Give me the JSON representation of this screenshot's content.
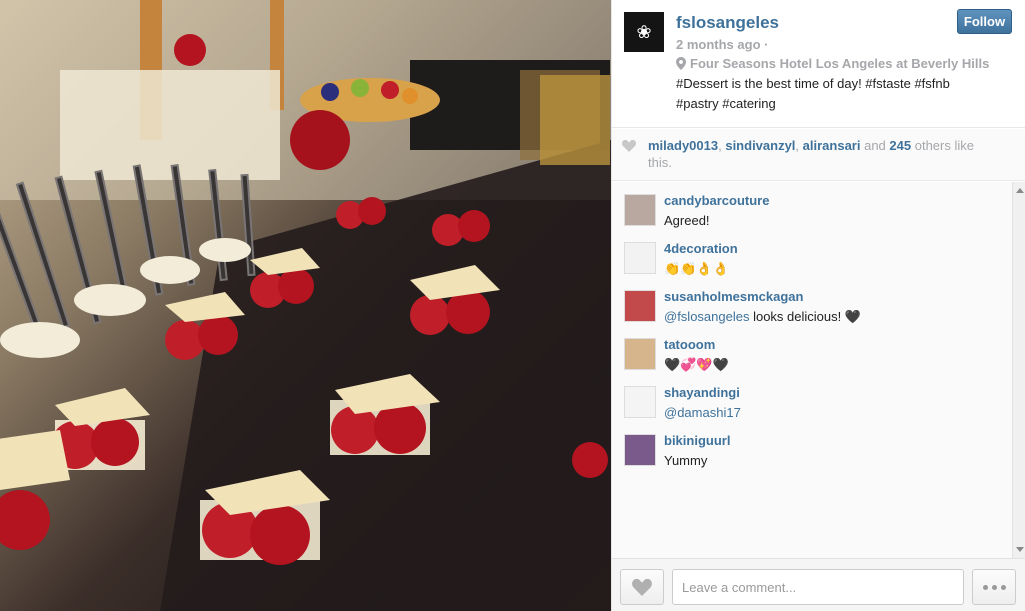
{
  "post": {
    "photo_alt": "Raspberry pastry desserts and spoons on a catering table",
    "author": "fslosangeles",
    "follow_label": "Follow",
    "time_ago": "2 months ago ·",
    "location": "Four Seasons Hotel Los Angeles at Beverly Hills",
    "caption_line1": "#Dessert is the best time of day! #fstaste #fsfnb",
    "caption_line2": "#pastry #catering"
  },
  "likes": {
    "users": [
      "milady0013",
      "sindivanzyl",
      "aliransari"
    ],
    "sep1": ", ",
    "sep2": ", ",
    "and_text": " and ",
    "count": "245",
    "others_text": " others like",
    "line2": "this."
  },
  "comments": [
    {
      "user": "candybarcouture",
      "text": "Agreed!",
      "avatar_color": "#b9a8a0"
    },
    {
      "user": "4decoration",
      "text": "👏👏👌👌",
      "avatar_color": "#f2f2f2"
    },
    {
      "user": "susanholmesmckagan",
      "mention": "@fslosangeles",
      "text": " looks delicious! 🖤",
      "avatar_color": "#c24a4a"
    },
    {
      "user": "tatooom",
      "text": "🖤💞💖🖤",
      "avatar_color": "#d6b48c"
    },
    {
      "user": "shayandingi",
      "mention": "@damashi17",
      "text": "",
      "avatar_color": "#f4f4f4"
    },
    {
      "user": "bikiniguurl",
      "text": "Yummy",
      "avatar_color": "#7a5a8a"
    }
  ],
  "footer": {
    "comment_placeholder": "Leave a comment...",
    "like_icon": "heart-icon",
    "more_icon": "ellipsis-icon"
  },
  "colors": {
    "link": "#3f729b",
    "muted": "#a5a7aa",
    "follow_button": "#3f729b"
  }
}
